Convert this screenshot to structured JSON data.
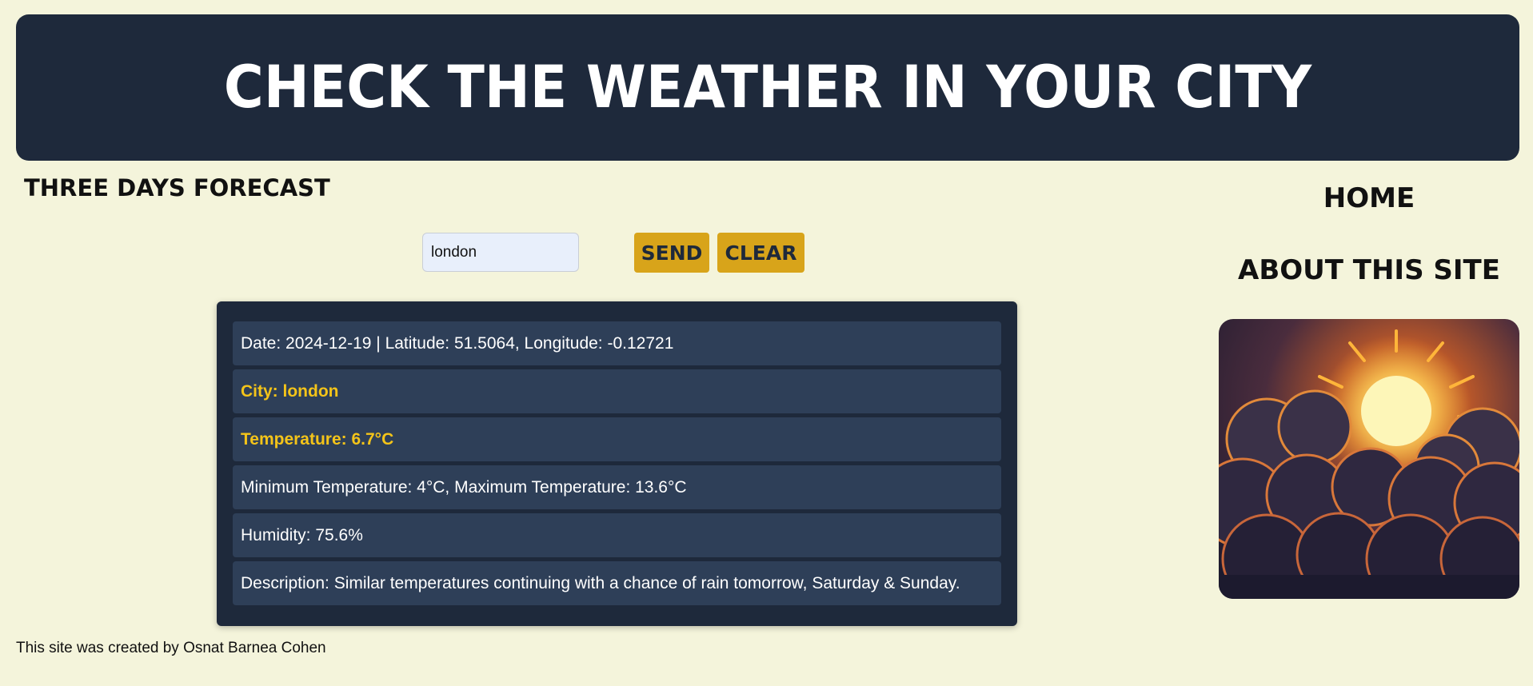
{
  "header": {
    "title": "Check the weather in your city"
  },
  "forecast_link": "Three days forecast",
  "search": {
    "value": "london"
  },
  "buttons": {
    "send": "Send",
    "clear": "Clear"
  },
  "weather": {
    "date_line": "Date: 2024-12-19 | Latitude: 51.5064, Longitude: -0.12721",
    "city_line": "City: london",
    "temperature_line": "Temperature: 6.7°C",
    "min_max_line": "Minimum Temperature: 4°C, Maximum Temperature: 13.6°C",
    "humidity_line": "Humidity: 75.6%",
    "description_line": "Description: Similar temperatures continuing with a chance of rain tomorrow, Saturday & Sunday."
  },
  "nav": {
    "home": "Home",
    "about": "About this site"
  },
  "footer": {
    "text": "This site was created by Osnat Barnea Cohen"
  },
  "colors": {
    "background": "#f4f4db",
    "header_bg": "#1e293b",
    "card_bg": "#1e293b",
    "row_bg": "#2e3f58",
    "accent_yellow": "#f4c419",
    "button_bg": "#d8a41a"
  },
  "image": {
    "icon": "sun-over-clouds-illustration"
  }
}
